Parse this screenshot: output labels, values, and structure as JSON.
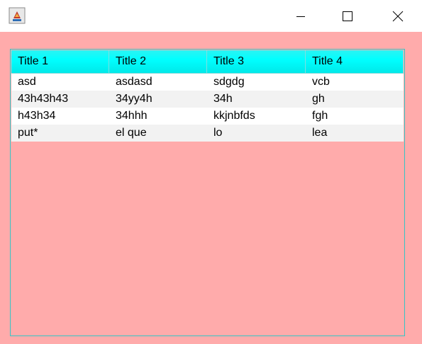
{
  "window": {
    "icon": "java-app-icon",
    "controls": [
      "minimize-icon",
      "maximize-icon",
      "close-icon"
    ]
  },
  "colors": {
    "background": "#ffabab",
    "header": "#00ffff",
    "border": "#34c6c6"
  },
  "table": {
    "headers": [
      "Title 1",
      "Title 2",
      "Title 3",
      "Title 4"
    ],
    "rows": [
      [
        "asd",
        "asdasd",
        "sdgdg",
        "vcb"
      ],
      [
        "43h43h43",
        "34yy4h",
        "34h",
        "gh"
      ],
      [
        "h43h34",
        "34hhh",
        "kkjnbfds",
        "fgh"
      ],
      [
        "put*",
        "el que",
        "lo",
        "lea"
      ]
    ]
  }
}
